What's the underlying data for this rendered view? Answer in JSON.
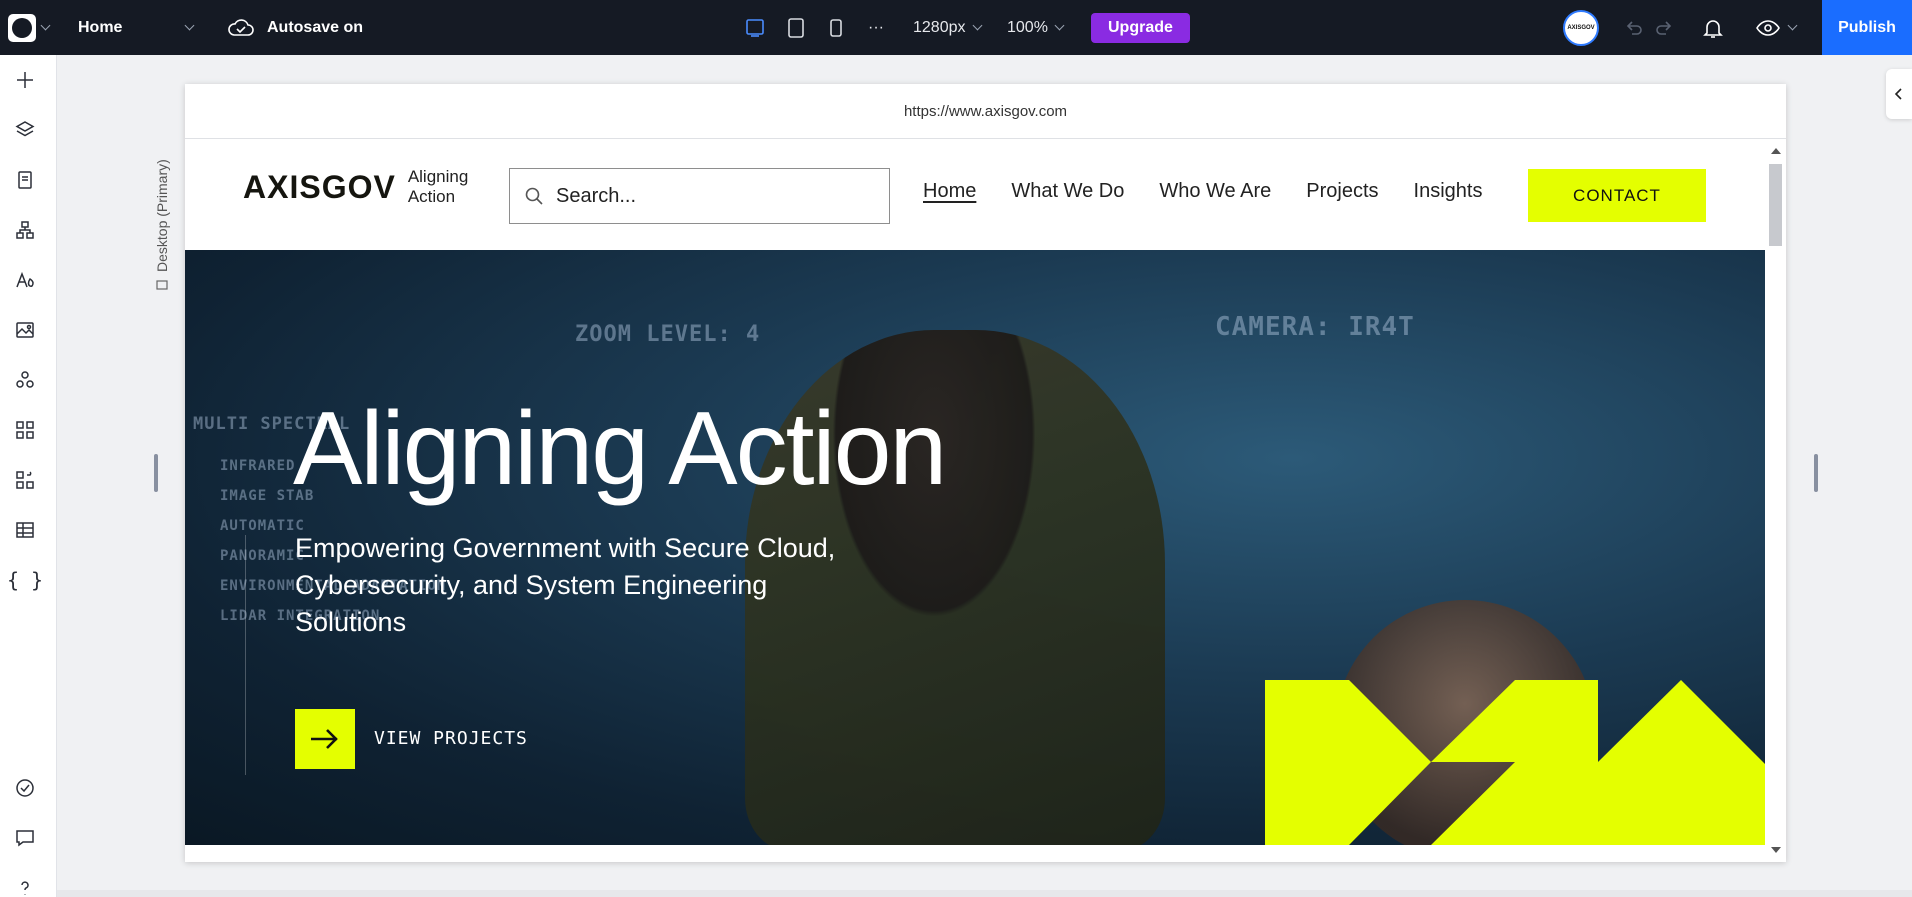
{
  "topbar": {
    "page_name": "Home",
    "autosave": "Autosave on",
    "breakpoint": "1280px",
    "zoom": "100%",
    "upgrade": "Upgrade",
    "avatar_text": "AXISGOV",
    "publish": "Publish",
    "more": "···"
  },
  "canvas": {
    "url": "https://www.axisgov.com",
    "device_label": "Desktop (Primary)"
  },
  "site": {
    "wordmark": "AXISGOV",
    "tagline": "Aligning Action",
    "search_placeholder": "Search...",
    "nav": [
      "Home",
      "What We Do",
      "Who We Are",
      "Projects",
      "Insights"
    ],
    "contact": "CONTACT",
    "hero_title": "Aligning Action",
    "hero_subtitle": "Empowering Government with Secure Cloud, Cybersecurity, and System Engineering Solutions",
    "cta_label": "VIEW PROJECTS",
    "hud": {
      "zoom": "ZOOM LEVEL: 4",
      "camera": "CAMERA: IR4T",
      "list": [
        "MULTI SPECTRAL",
        "INFRARED",
        "IMAGE STAB",
        "AUTOMATIC",
        "PANORAMIC",
        "ENVIRONMENTAL ADAPTATION",
        "LIDAR INTEGRATION"
      ]
    }
  },
  "colors": {
    "topbar": "#151a24",
    "upgrade": "#8a2be2",
    "publish": "#1a6dff",
    "accent_lime": "#e4ff00"
  }
}
